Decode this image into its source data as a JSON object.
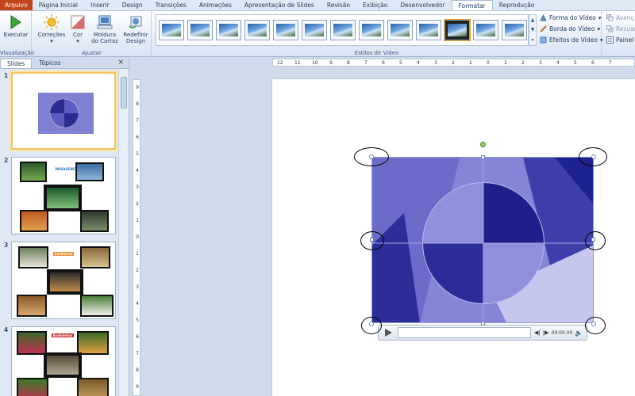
{
  "tabs": [
    "Arquivo",
    "Página Inicial",
    "Inserir",
    "Design",
    "Transições",
    "Animações",
    "Apresentação de Slides",
    "Revisão",
    "Exibição",
    "Desenvolvedor",
    "Formatar",
    "Reprodução"
  ],
  "active_tab": "Formatar",
  "ribbon": {
    "preview_group": {
      "label": "Visualização",
      "execute": "Executar"
    },
    "adjust_group": {
      "label": "Ajustar",
      "corrections": "Correções",
      "color": "Cor",
      "poster_frame_1": "Moldura",
      "poster_frame_2": "do Cartaz",
      "reset_1": "Redefinir",
      "reset_2": "Design"
    },
    "video_styles": {
      "label": "Estilos de Vídeo",
      "shape": "Forma do Vídeo",
      "border": "Borda do Vídeo",
      "effects": "Efeitos de Vídeo"
    },
    "arrange": {
      "forward": "Avanç",
      "backward": "Recuar",
      "pane": "Painel"
    }
  },
  "pane": {
    "tab_slides": "Slides",
    "tab_outlines": "Tópicos",
    "close": "×",
    "slides": [
      {
        "num": "1"
      },
      {
        "num": "2",
        "caption": "PAISAGENS"
      },
      {
        "num": "3",
        "caption": "Cachorros"
      },
      {
        "num": "4",
        "caption": "Borboletas"
      }
    ]
  },
  "ruler_h": [
    "12",
    "11",
    "10",
    "9",
    "8",
    "7",
    "6",
    "5",
    "4",
    "3",
    "2",
    "1",
    "0",
    "1",
    "2",
    "3",
    "4",
    "5",
    "6",
    "7"
  ],
  "ruler_v": [
    "9",
    "8",
    "7",
    "6",
    "5",
    "4",
    "3",
    "2",
    "1",
    "0",
    "1",
    "2",
    "3",
    "4",
    "5",
    "6",
    "7",
    "8",
    "9"
  ],
  "player": {
    "time": "00:00.00"
  },
  "colors": {
    "file_tab": "#c4441c",
    "video_bg": "#7e7fd0",
    "video_dark": "#262a8f",
    "selection": "#f4c463"
  }
}
